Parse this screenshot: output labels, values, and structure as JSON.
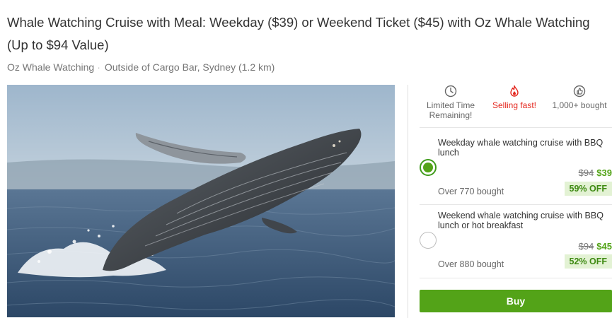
{
  "deal": {
    "title": "Whale Watching Cruise with Meal: Weekday ($39) or Weekend Ticket ($45) with Oz Whale Watching (Up to $94 Value)",
    "merchant": "Oz Whale Watching",
    "location": "Outside of Cargo Bar, Sydney (1.2 km)"
  },
  "badges": [
    {
      "icon": "clock-icon",
      "label_line1": "Limited Time",
      "label_line2": "Remaining!"
    },
    {
      "icon": "flame-icon",
      "label_line1": "Selling fast!",
      "color": "#e4251c"
    },
    {
      "icon": "thumbs-up-icon",
      "label_line1": "1,000+ bought"
    }
  ],
  "options": [
    {
      "title": "Weekday whale watching cruise with BBQ lunch",
      "old_price": "$94",
      "new_price": "$39",
      "bought": "Over 770 bought",
      "discount": "59% OFF",
      "selected": true
    },
    {
      "title": "Weekend whale watching cruise with BBQ lunch or hot breakfast",
      "old_price": "$94",
      "new_price": "$45",
      "bought": "Over 880 bought",
      "discount": "52% OFF",
      "selected": false
    }
  ],
  "buy_label": "Buy",
  "colors": {
    "accent": "#53a318",
    "selling_fast": "#e4251c",
    "discount_bg": "#e3f2d4"
  }
}
